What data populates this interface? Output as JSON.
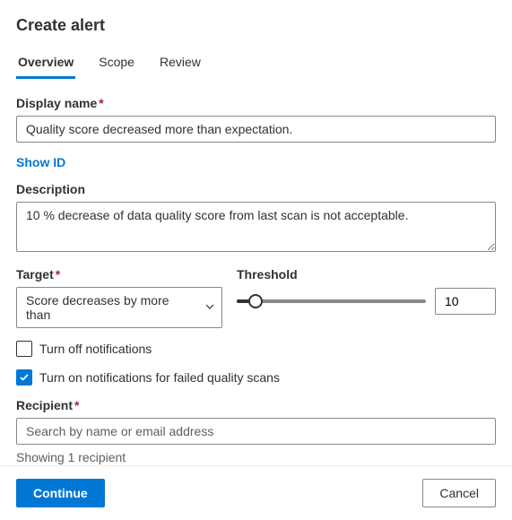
{
  "header": {
    "title": "Create alert"
  },
  "tabs": {
    "overview": "Overview",
    "scope": "Scope",
    "review": "Review"
  },
  "form": {
    "displayName": {
      "label": "Display name",
      "value": "Quality score decreased more than expectation."
    },
    "showId": "Show ID",
    "description": {
      "label": "Description",
      "value": "10 % decrease of data quality score from last scan is not acceptable."
    },
    "target": {
      "label": "Target",
      "selected": "Score decreases by more than"
    },
    "threshold": {
      "label": "Threshold",
      "value": "10"
    },
    "turnOffNotifications": "Turn off notifications",
    "turnOnFailedScans": "Turn on notifications for failed quality scans",
    "recipient": {
      "label": "Recipient",
      "placeholder": "Search by name or email address",
      "status": "Showing 1 recipient"
    }
  },
  "footer": {
    "continue": "Continue",
    "cancel": "Cancel"
  }
}
